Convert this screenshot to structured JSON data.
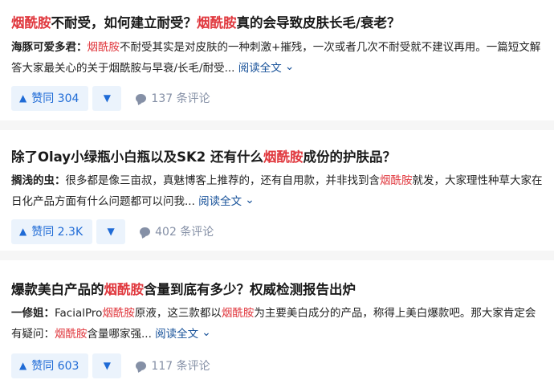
{
  "answers": [
    {
      "title_parts": [
        {
          "text": "烟酰胺",
          "hl": true
        },
        {
          "text": "不耐受，如何建立耐受？",
          "hl": false
        },
        {
          "text": "烟酰胺",
          "hl": true
        },
        {
          "text": "真的会导致皮肤长毛/衰老？",
          "hl": false
        }
      ],
      "author": "海豚可爱多君：",
      "excerpt_parts": [
        {
          "text": "烟酰胺",
          "hl": true
        },
        {
          "text": "不耐受其实是对皮肤的一种刺激+摧残，一次或者几次不耐受就不建议再用。一篇短文解答大家最关心的关于烟酰胺与早衰/长毛/耐受...",
          "hl": false
        }
      ],
      "read_more": "阅读全文",
      "upvote_label": "赞同 304",
      "comments_label": "137 条评论"
    },
    {
      "title_parts": [
        {
          "text": "除了Olay小绿瓶小白瓶以及SK2 还有什么",
          "hl": false
        },
        {
          "text": "烟酰胺",
          "hl": true
        },
        {
          "text": "成份的护肤品？",
          "hl": false
        }
      ],
      "author": "搁浅的虫：",
      "excerpt_parts": [
        {
          "text": "很多都是像三亩叔，真魅博客上推荐的，还有自用款，并非找到含",
          "hl": false
        },
        {
          "text": "烟酰胺",
          "hl": true
        },
        {
          "text": "就发，大家理性种草大家在日化产品方面有什么问题都可以问我...",
          "hl": false
        }
      ],
      "read_more": "阅读全文",
      "upvote_label": "赞同 2.3K",
      "comments_label": "402 条评论"
    },
    {
      "title_parts": [
        {
          "text": "爆款美白产品的",
          "hl": false
        },
        {
          "text": "烟酰胺",
          "hl": true
        },
        {
          "text": "含量到底有多少？权威检测报告出炉",
          "hl": false
        }
      ],
      "author": "一修姐：",
      "excerpt_parts": [
        {
          "text": "FacialPro",
          "hl": false
        },
        {
          "text": "烟酰胺",
          "hl": true
        },
        {
          "text": "原液，这三款都以",
          "hl": false
        },
        {
          "text": "烟酰胺",
          "hl": true
        },
        {
          "text": "为主要美白成分的产品，称得上美白爆款吧。那大家肯定会有疑问：",
          "hl": false
        },
        {
          "text": "烟酰胺",
          "hl": true
        },
        {
          "text": "含量哪家强...",
          "hl": false
        }
      ],
      "read_more": "阅读全文",
      "upvote_label": "赞同 603",
      "comments_label": "117 条评论"
    }
  ],
  "colors": {
    "highlight": "#e0383e",
    "link": "#175199",
    "vote_bg": "#ebf3fc",
    "vote_text": "#1f6bd6",
    "muted": "#8590a6",
    "page_bg": "#f6f6f6"
  },
  "icons": {
    "upvote": "triangle-up-icon",
    "downvote": "triangle-down-icon",
    "read_more": "chevron-down-icon",
    "comment": "comment-bubble-icon"
  }
}
